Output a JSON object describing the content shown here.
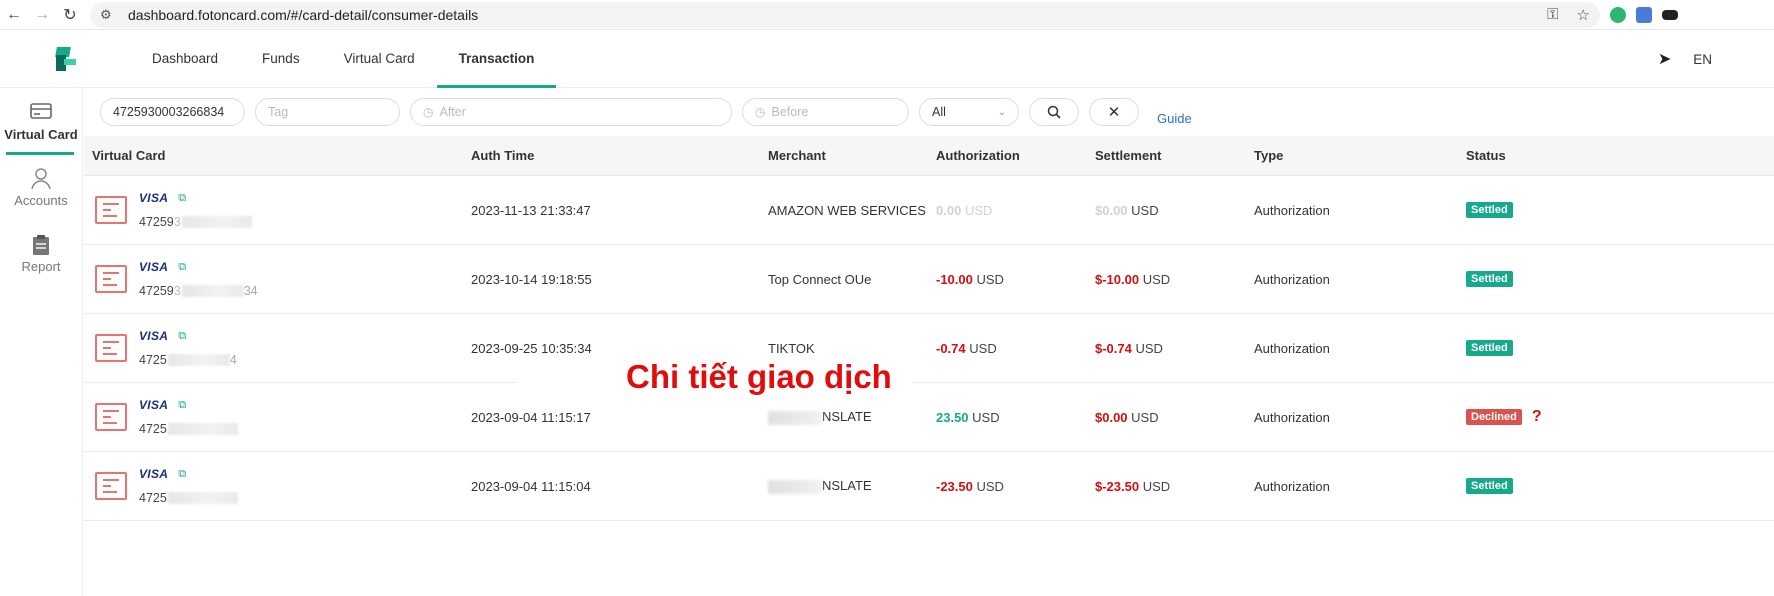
{
  "browser": {
    "url": "dashboard.fotoncard.com/#/card-detail/consumer-details"
  },
  "header": {
    "tabs": [
      {
        "label": "Dashboard"
      },
      {
        "label": "Funds"
      },
      {
        "label": "Virtual Card"
      },
      {
        "label": "Transaction"
      }
    ],
    "active_tab": "Transaction",
    "language": "EN"
  },
  "sidebar": {
    "items": [
      {
        "label": "Virtual Card",
        "icon": "credit-card-icon"
      },
      {
        "label": "Accounts",
        "icon": "user-icon"
      },
      {
        "label": "Report",
        "icon": "clipboard-icon"
      }
    ],
    "active": "Virtual Card"
  },
  "filters": {
    "card_number": "4725930003266834",
    "tag_placeholder": "Tag",
    "after_placeholder": "After",
    "before_placeholder": "Before",
    "status_select": "All",
    "guide_label": "Guide"
  },
  "table": {
    "columns": [
      "Virtual Card",
      "Auth Time",
      "Merchant",
      "Authorization",
      "Settlement",
      "Type",
      "Status"
    ],
    "rows": [
      {
        "brand": "VISA",
        "card_prefix": "47259",
        "card_visible": "3",
        "card_suffix": "",
        "auth_time": "2023-11-13 21:33:47",
        "merchant": "AMAZON WEB SERVICES",
        "merchant_blurred": false,
        "authorization": "0.00",
        "auth_currency": "USD",
        "settlement": "$0.00",
        "settle_currency": "USD",
        "type": "Authorization",
        "status": "Settled"
      },
      {
        "brand": "VISA",
        "card_prefix": "47259",
        "card_visible": "3",
        "card_suffix": "34",
        "auth_time": "2023-10-14 19:18:55",
        "merchant": "Top Connect OUe",
        "merchant_blurred": false,
        "authorization": "-10.00",
        "auth_currency": "USD",
        "settlement": "$-10.00",
        "settle_currency": "USD",
        "type": "Authorization",
        "status": "Settled"
      },
      {
        "brand": "VISA",
        "card_prefix": "4725",
        "card_visible": "",
        "card_suffix": "4",
        "auth_time": "2023-09-25 10:35:34",
        "merchant": "TIKTOK",
        "merchant_blurred": false,
        "authorization": "-0.74",
        "auth_currency": "USD",
        "settlement": "$-0.74",
        "settle_currency": "USD",
        "type": "Authorization",
        "status": "Settled"
      },
      {
        "brand": "VISA",
        "card_prefix": "4725",
        "card_visible": "",
        "card_suffix": "",
        "auth_time": "2023-09-04 11:15:17",
        "merchant": "NSLATE",
        "merchant_blurred": true,
        "authorization": "23.50",
        "auth_currency": "USD",
        "settlement": "$0.00",
        "settle_currency": "USD",
        "type": "Authorization",
        "status": "Declined",
        "status_note": "?"
      },
      {
        "brand": "VISA",
        "card_prefix": "4725",
        "card_visible": "",
        "card_suffix": "",
        "auth_time": "2023-09-04 11:15:04",
        "merchant": "NSLATE",
        "merchant_blurred": true,
        "authorization": "-23.50",
        "auth_currency": "USD",
        "settlement": "$-23.50",
        "settle_currency": "USD",
        "type": "Authorization",
        "status": "Settled"
      }
    ]
  },
  "overlay_caption": "Chi tiết giao dịch",
  "colors": {
    "accent": "#17a98c",
    "negative": "#d40f0f",
    "declined": "#d9534f",
    "card_icon": "#e8736f",
    "overlay_text": "#e10c0c"
  }
}
